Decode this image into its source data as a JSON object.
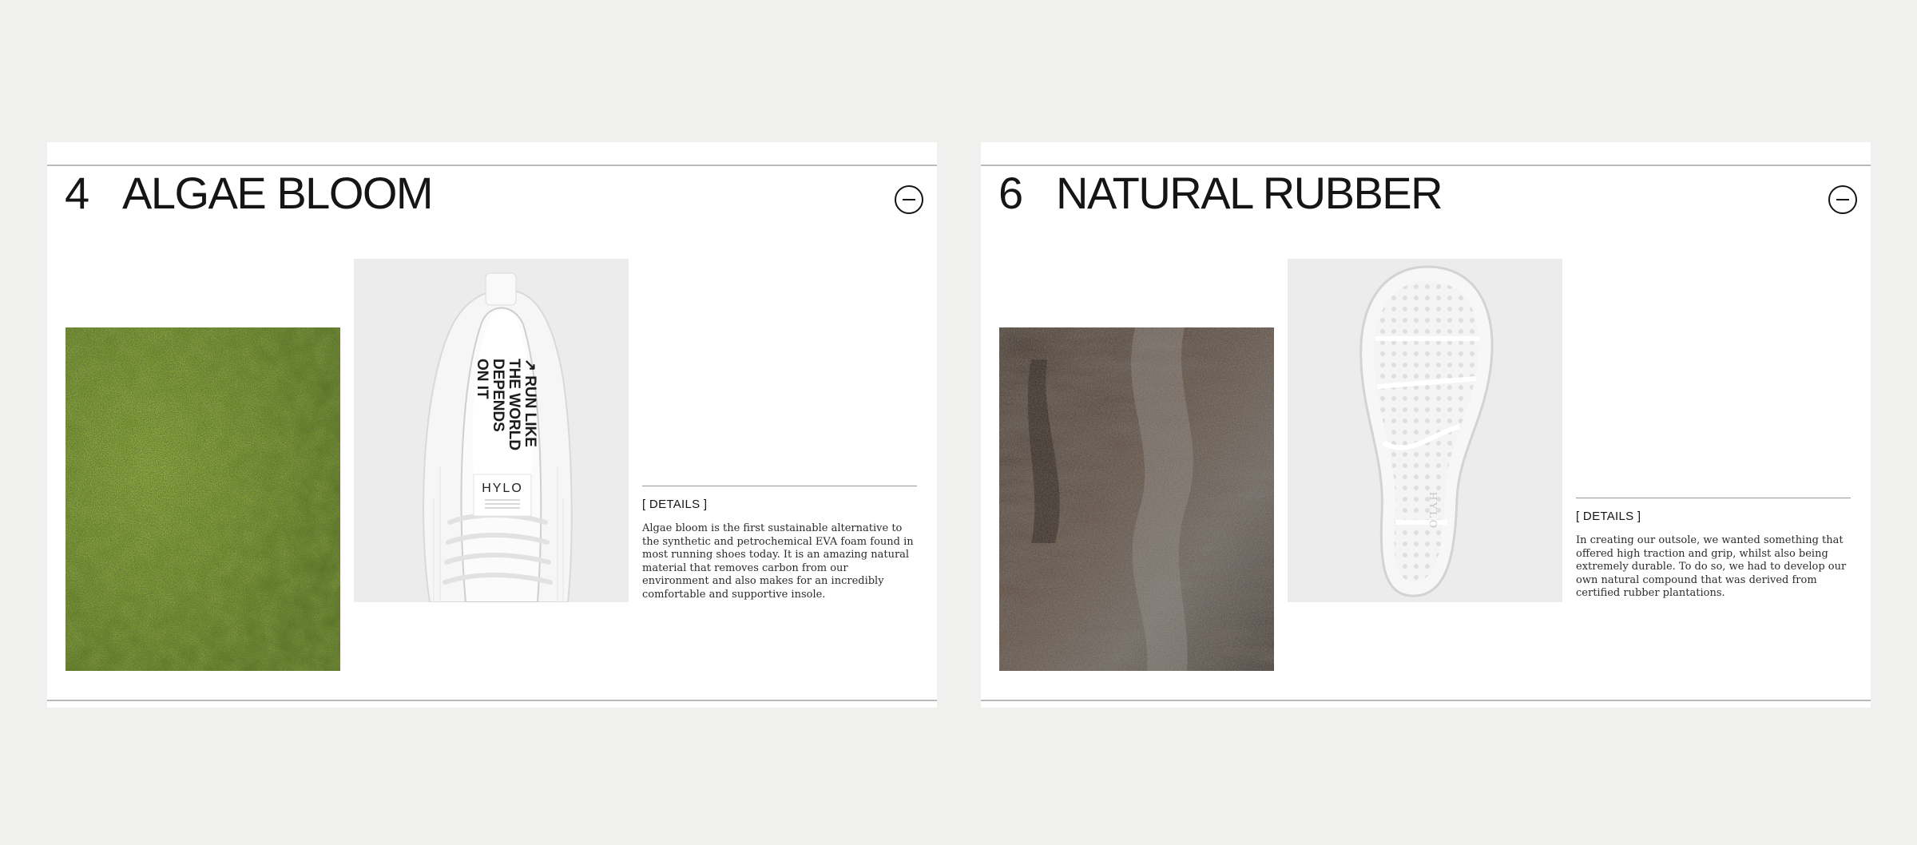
{
  "cards": [
    {
      "number": "4",
      "title": "ALGAE BLOOM",
      "details_label": "[ DETAILS ]",
      "details_text": "Algae bloom is the first sustainable alternative to the synthetic and petrochemical EVA foam found in most running shoes today. It is an amazing natural material that removes carbon from our environment and also makes for an incredibly comfortable and supportive insole.",
      "insole_text": [
        "↗ RUN LIKE",
        "THE WORLD",
        "DEPENDS",
        "ON IT"
      ],
      "tongue_logo": "HYLO",
      "material_image": "algae-texture",
      "product_image": "white-knit-shoe-top-view"
    },
    {
      "number": "6",
      "title": "NATURAL RUBBER",
      "details_label": "[ DETAILS ]",
      "details_text": "In creating our outsole, we wanted something that offered high traction and grip, whilst also being extremely durable. To do so, we had to develop our own natural compound that was derived from certified rubber plantations.",
      "sole_logo": "HYLO",
      "material_image": "tree-bark-texture",
      "product_image": "white-outsole-bottom-view"
    }
  ],
  "icons": {
    "collapse": "minus-circle-icon"
  },
  "colors": {
    "background": "#f0f0ef",
    "card": "#ffffff",
    "text": "#151515",
    "algae": "#7a9a2a",
    "bark": "#4a3f37"
  }
}
